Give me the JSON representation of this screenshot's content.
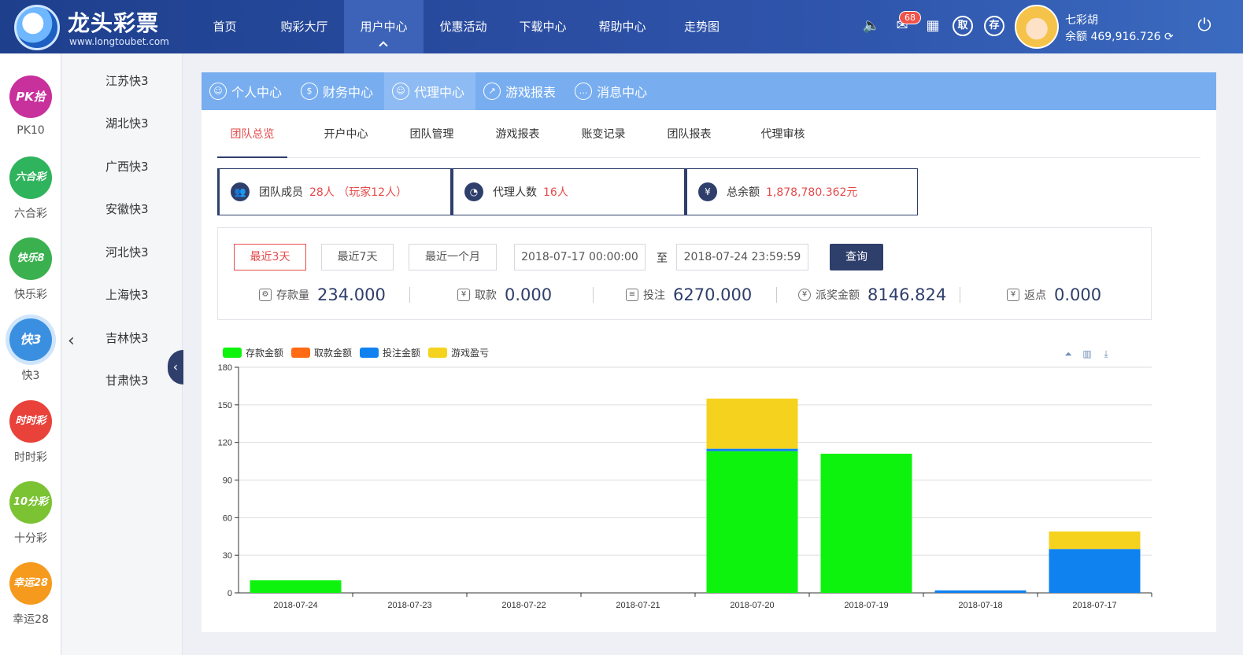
{
  "header": {
    "logo_title": "龙头彩票",
    "logo_url": "www.longtoubet.com",
    "nav": [
      "首页",
      "购彩大厅",
      "用户中心",
      "优惠活动",
      "下载中心",
      "帮助中心",
      "走势图"
    ],
    "mail_badge": "68",
    "withdraw_label": "取",
    "deposit_label": "存",
    "user_name": "七彩胡",
    "balance": "余额 469,916.726 ⟳"
  },
  "rail": {
    "games": [
      {
        "ball": "PK拾",
        "label": "PK10",
        "color": "#c8309c"
      },
      {
        "ball": "六合彩",
        "label": "六合彩",
        "color": "#2fb35c"
      },
      {
        "ball": "快乐8",
        "label": "快乐彩",
        "color": "#3bb04f"
      },
      {
        "ball": "快3",
        "label": "快3",
        "color": "#3a8fe0"
      },
      {
        "ball": "时时彩",
        "label": "时时彩",
        "color": "#e9423a"
      },
      {
        "ball": "10分彩",
        "label": "十分彩",
        "color": "#7cc334"
      },
      {
        "ball": "幸运28",
        "label": "幸运28",
        "color": "#f59a1d"
      }
    ],
    "sub_items": [
      "江苏快3",
      "湖北快3",
      "广西快3",
      "安徽快3",
      "河北快3",
      "上海快3",
      "吉林快3",
      "甘肃快3"
    ]
  },
  "tabs": [
    {
      "label": "个人中心",
      "icon": "user-icon",
      "glyph": "☺"
    },
    {
      "label": "财务中心",
      "icon": "dollar-icon",
      "glyph": "$"
    },
    {
      "label": "代理中心",
      "icon": "agent-icon",
      "glyph": "☺"
    },
    {
      "label": "游戏报表",
      "icon": "trend-icon",
      "glyph": "↗"
    },
    {
      "label": "消息中心",
      "icon": "message-icon",
      "glyph": "…"
    }
  ],
  "subtabs": [
    "团队总览",
    "开户中心",
    "团队管理",
    "游戏报表",
    "账变记录",
    "团队报表",
    "代理审核"
  ],
  "stats": [
    {
      "label": "团队成员",
      "value": "28人 （玩家12人）",
      "icon": "team-icon"
    },
    {
      "label": "代理人数",
      "value": "16人",
      "icon": "pie-icon"
    },
    {
      "label": "总余额",
      "value": "1,878,780.362元",
      "icon": "money-bag-icon"
    }
  ],
  "filters": {
    "btn_3days": "最近3天",
    "btn_7days": "最近7天",
    "btn_month": "最近一个月",
    "date_from": "2018-07-17 00:00:00",
    "to_label": "至",
    "date_to": "2018-07-24 23:59:59",
    "query": "查询"
  },
  "summary": [
    {
      "label": "存款量",
      "value": "234.000",
      "icon": "deposit-icon"
    },
    {
      "label": "取款",
      "value": "0.000",
      "icon": "withdraw-icon"
    },
    {
      "label": "投注",
      "value": "6270.000",
      "icon": "bet-icon"
    },
    {
      "label": "派奖金额",
      "value": "8146.824",
      "icon": "yen-icon"
    },
    {
      "label": "返点",
      "value": "0.000",
      "icon": "rebate-icon"
    }
  ],
  "colors": {
    "deposit": "#0ef30e",
    "withdraw": "#ff6a13",
    "bet": "#0f82f0",
    "profit": "#f5d21e"
  },
  "chart_data": {
    "type": "bar",
    "stacked": true,
    "categories": [
      "2018-07-24",
      "2018-07-23",
      "2018-07-22",
      "2018-07-21",
      "2018-07-20",
      "2018-07-19",
      "2018-07-18",
      "2018-07-17"
    ],
    "series": [
      {
        "name": "存款金额",
        "color": "#0ef30e",
        "values": [
          10,
          0,
          0,
          0,
          113,
          111,
          0,
          0
        ]
      },
      {
        "name": "取款金额",
        "color": "#ff6a13",
        "values": [
          0,
          0,
          0,
          0,
          0,
          0,
          0,
          0
        ]
      },
      {
        "name": "投注金额",
        "color": "#0f82f0",
        "values": [
          0,
          0,
          0,
          0,
          2,
          0,
          2,
          35
        ]
      },
      {
        "name": "游戏盈亏",
        "color": "#f5d21e",
        "values": [
          0,
          0,
          0,
          0,
          40,
          0,
          0,
          14
        ]
      }
    ],
    "ylim": [
      0,
      180
    ],
    "yticks": [
      0,
      30,
      60,
      90,
      120,
      150,
      180
    ],
    "grid": true,
    "legend": "top-left"
  }
}
